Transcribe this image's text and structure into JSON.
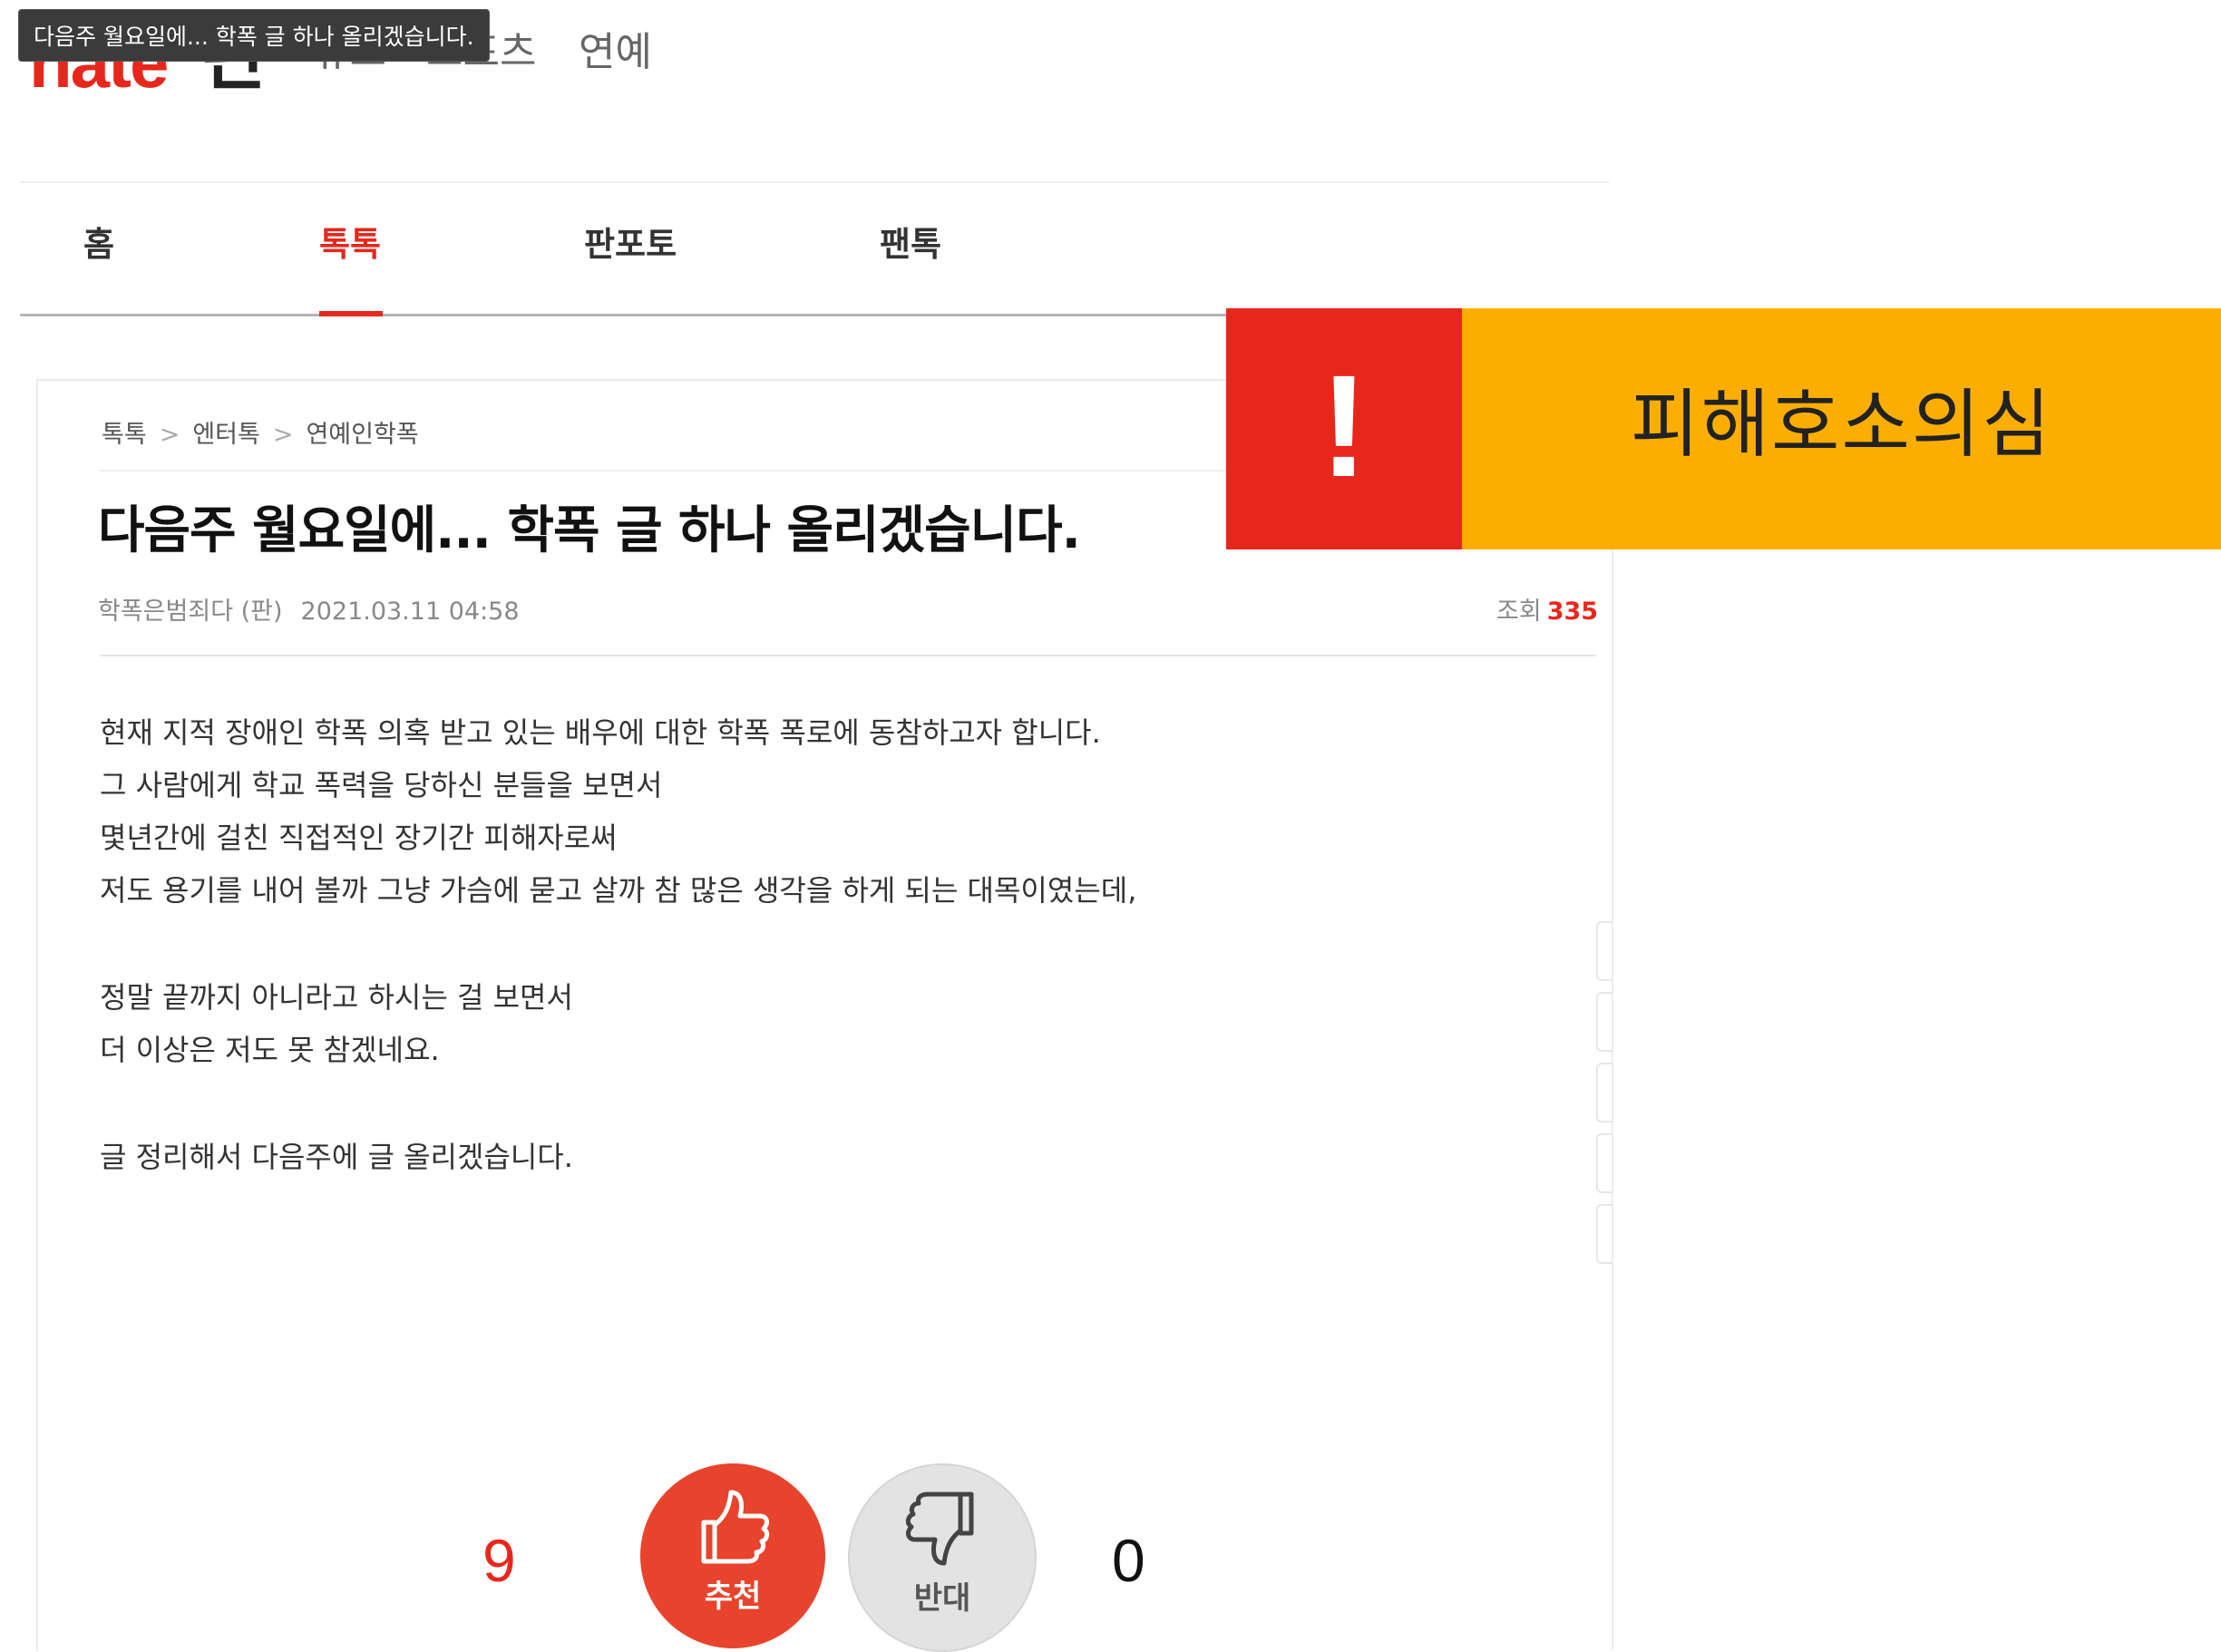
{
  "header": {
    "logo": "nate",
    "logo_pan": "판",
    "services": [
      "뉴스",
      "스포츠",
      "연예"
    ],
    "tooltip": "다음주 월요일에... 학폭 글 하나 올리겠습니다."
  },
  "nav": {
    "items": [
      {
        "label": "홈"
      },
      {
        "label": "톡톡",
        "active": true
      },
      {
        "label": "판포토"
      },
      {
        "label": "팬톡"
      }
    ]
  },
  "breadcrumb": [
    "톡톡",
    "엔터톡",
    "연예인학폭"
  ],
  "post": {
    "title": "다음주 월요일에... 학폭 글 하나 올리겠습니다.",
    "author": "학폭은범죄다 (판)",
    "date": "2021.03.11 04:58",
    "views_label": "조회",
    "views": "335",
    "body": [
      "현재 지적 장애인 학폭 의혹 받고 있는 배우에 대한 학폭 폭로에 동참하고자 합니다.",
      "그 사람에게 학교 폭력을 당하신 분들을 보면서",
      "몇년간에 걸친 직접적인 장기간 피해자로써",
      "저도 용기를 내어 볼까 그냥 가슴에 묻고 살까 참 많은 생각을 하게 되는 대목이였는데,",
      "정말 끝까지 아니라고 하시는 걸 보면서",
      "더 이상은 저도 못 참겠네요.",
      "글 정리해서 다음주에 글 올리겠습니다."
    ]
  },
  "banner": {
    "mark": "!",
    "text": "피해호소의심",
    "colors": {
      "red": "#e8271c",
      "orange": "#fcae00"
    }
  },
  "vote": {
    "up_count": "9",
    "up_label": "추천",
    "down_count": "0",
    "down_label": "반대"
  }
}
